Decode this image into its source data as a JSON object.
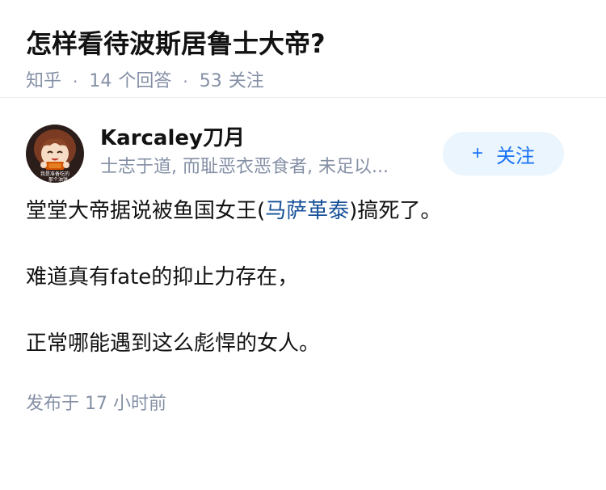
{
  "question": {
    "title": "怎样看待波斯居鲁士大帝?",
    "source": "知乎",
    "answer_count": "14",
    "answer_label": "个回答",
    "follow_count": "53",
    "follow_label": "关注"
  },
  "author": {
    "name": "Karcaley刀月",
    "bio": "士志于道, 而耻恶衣恶食者, 未足以...",
    "avatar_icon": "anime-character-avatar",
    "avatar_caption_1": "我是准备吃的",
    "avatar_caption_2": "那个油饼"
  },
  "follow_button": {
    "plus": "+",
    "label": "关注"
  },
  "answer": {
    "para1_before": "堂堂大帝据说被鱼国女王(",
    "para1_link": "马萨革泰",
    "para1_after": ")搞死了。",
    "para2": "难道真有fate的抑止力存在，",
    "para3": "正常哪能遇到这么彪悍的女人。",
    "time": "发布于  17 小时前"
  },
  "colors": {
    "link": "#175199",
    "meta": "#8590a6",
    "follow_bg": "#ebf5fd",
    "follow_text": "#1772f6"
  }
}
